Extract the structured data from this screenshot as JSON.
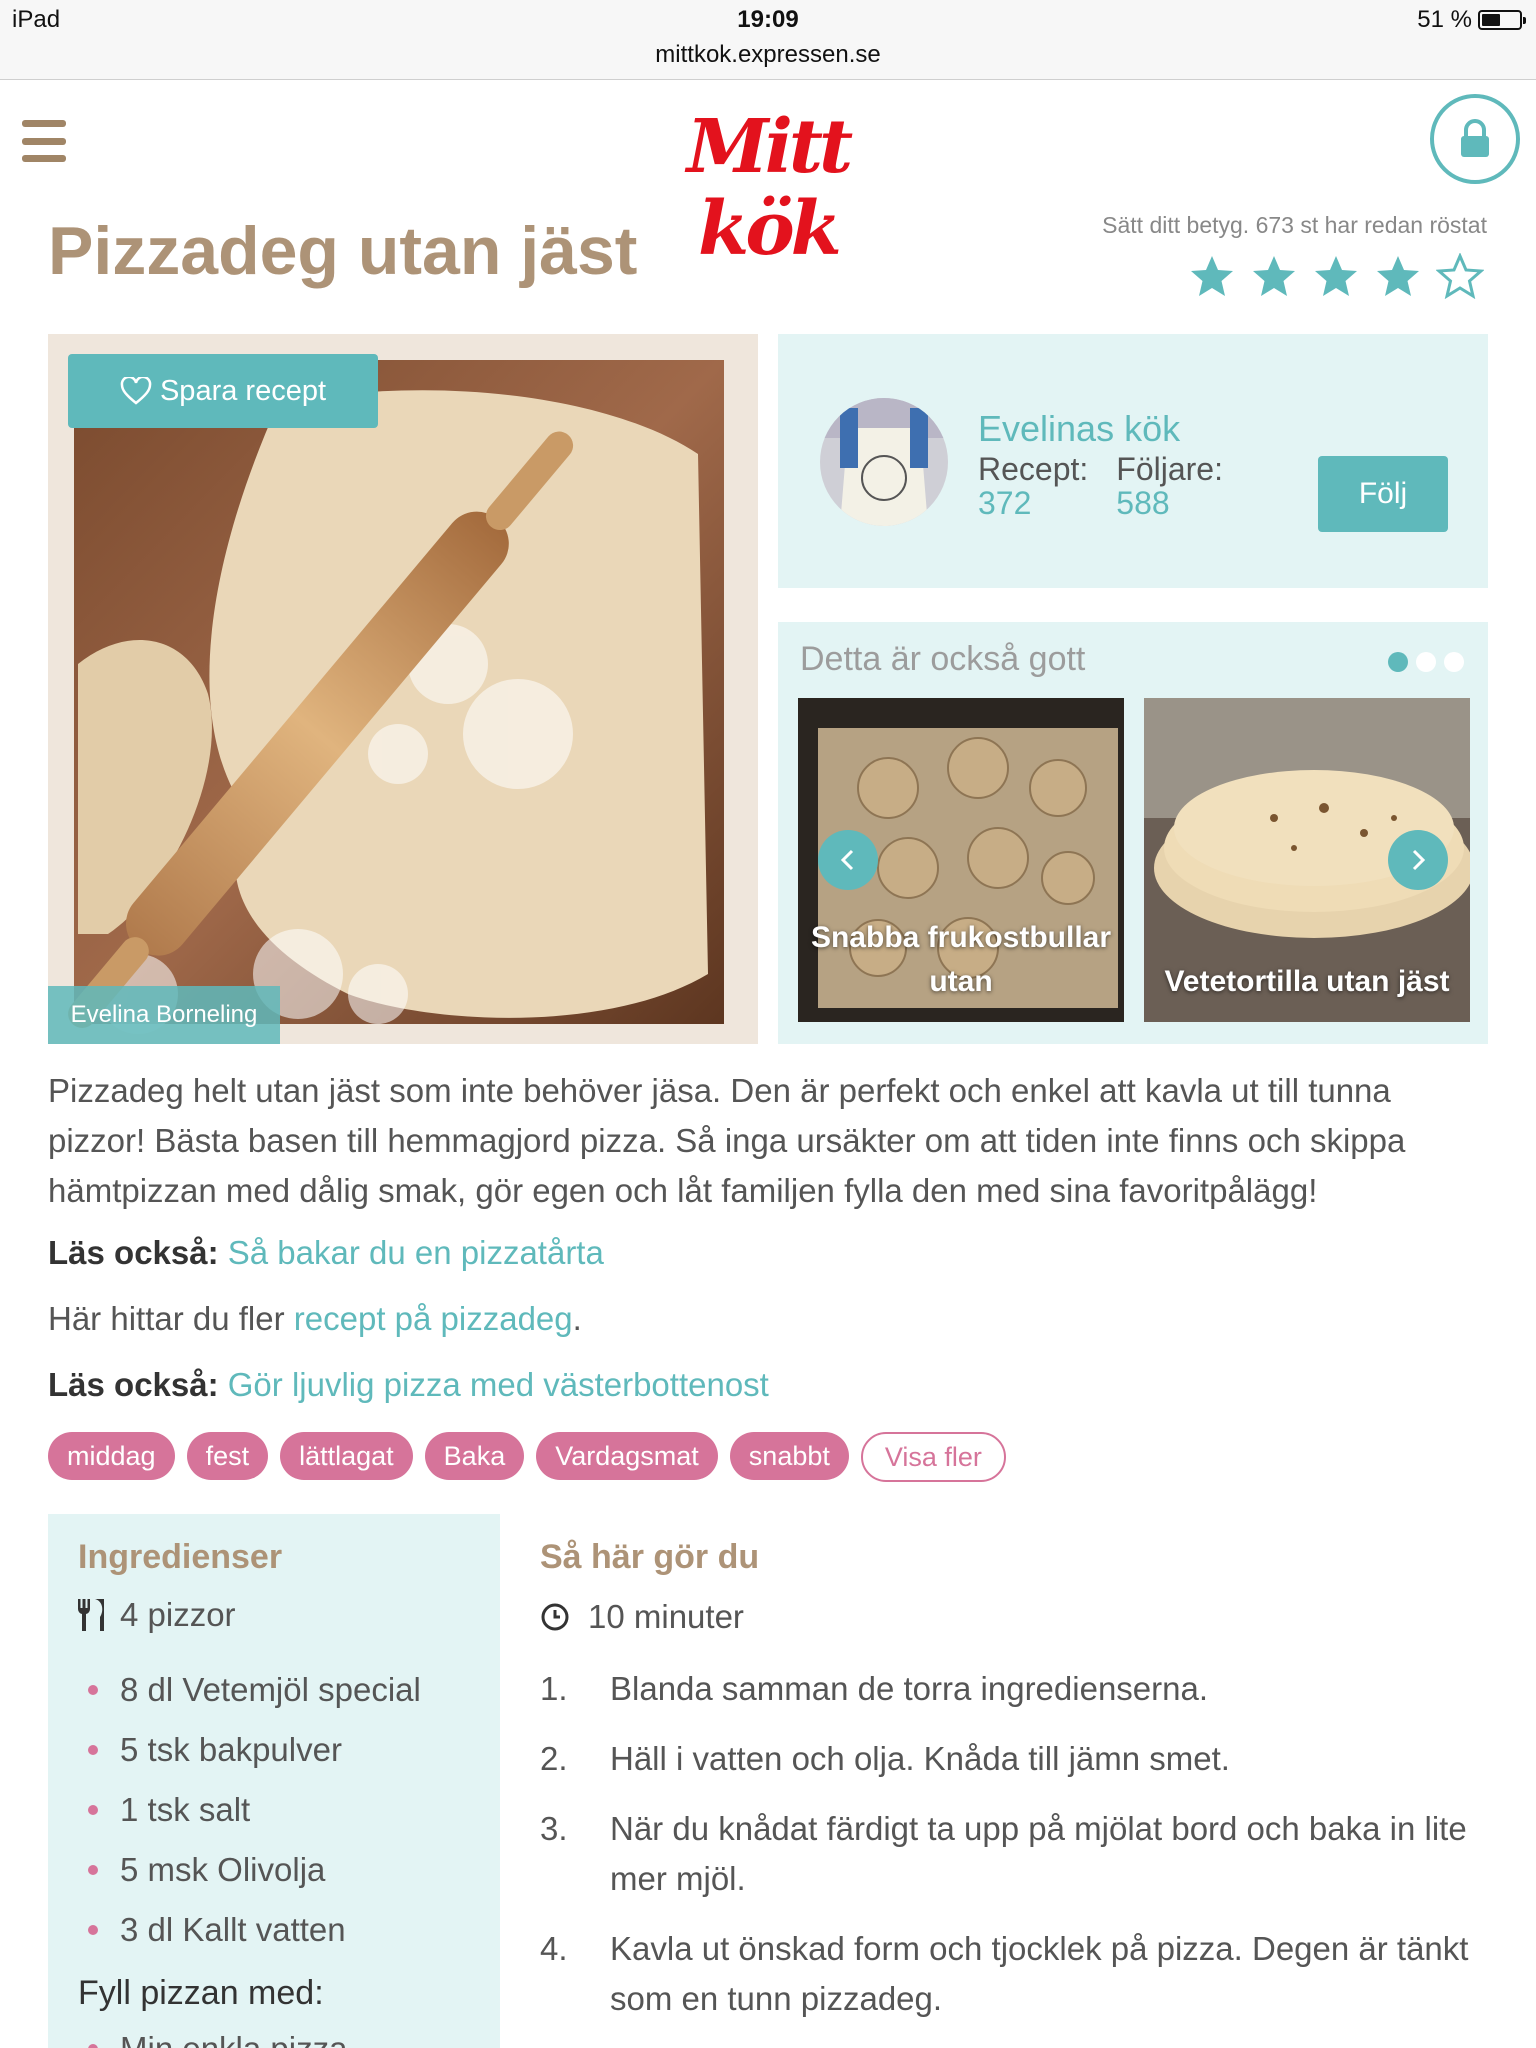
{
  "status_bar": {
    "device": "iPad",
    "time": "19:09",
    "url": "mittkok.expressen.se",
    "battery": "51 %",
    "battery_level": 0.51
  },
  "header": {
    "logo": "Mitt kök",
    "menu_icon": "hamburger-menu-icon",
    "lock_icon": "lock-icon"
  },
  "recipe": {
    "title": "Pizzadeg utan jäst",
    "rating_text": "Sätt ditt betyg. 673 st har redan röstat",
    "rating": 4,
    "rating_max": 5,
    "save_label": "Spara recept",
    "photo_credit": "Evelina Borneling"
  },
  "author": {
    "name": "Evelinas kök",
    "recipes_label": "Recept:",
    "recipes_count": "372",
    "followers_label": "Följare:",
    "followers_count": "588",
    "follow_label": "Följ"
  },
  "suggestions": {
    "title": "Detta är också gott",
    "items": [
      {
        "label": "Snabba frukostbullar utan"
      },
      {
        "label": "Vetetortilla utan jäst"
      }
    ]
  },
  "description": "Pizzadeg helt utan jäst som inte behöver jäsa. Den är perfekt och enkel att kavla ut till tunna pizzor! Bästa basen till hemmagjord pizza. Så inga ursäkter om att tiden inte finns och skippa hämtpizzan med dålig smak, gör egen och låt familjen fylla den med sina favoritpålägg!",
  "read_also_1": {
    "label": "Läs också:",
    "link": "Så bakar du en pizzatårta"
  },
  "more_line": {
    "prefix": "Här hittar du fler ",
    "link": "recept på pizzadeg",
    "suffix": "."
  },
  "read_also_2": {
    "label": "Läs också:",
    "link": "Gör ljuvlig pizza med västerbottenost"
  },
  "tags": [
    "middag",
    "fest",
    "lättlagat",
    "Baka",
    "Vardagsmat",
    "snabbt"
  ],
  "show_more_tags": "Visa fler",
  "ingredients": {
    "title": "Ingredienser",
    "portions": "4 pizzor",
    "items": [
      "8 dl Vetemjöl special",
      "5 tsk bakpulver",
      "1 tsk salt",
      "5 msk Olivolja",
      "3 dl Kallt vatten"
    ],
    "fill_title": "Fyll pizzan med:",
    "fill_items": [
      "Min enkla pizza"
    ]
  },
  "instructions": {
    "title": "Så här gör du",
    "time": "10 minuter",
    "steps": [
      {
        "num": "1.",
        "text": "Blanda samman de torra ingredienserna."
      },
      {
        "num": "2.",
        "text": "Häll i vatten och olja. Knåda till jämn smet."
      },
      {
        "num": "3.",
        "text": "När du knådat färdigt ta upp på mjölat bord och baka in lite mer mjöl."
      },
      {
        "num": "4.",
        "text": "Kavla ut önskad form och tjocklek på pizza. Degen är tänkt som en tunn pizzadeg."
      }
    ]
  },
  "colors": {
    "accent": "#5fb9bb",
    "title": "#ad9377",
    "tag": "#d6749a",
    "panel": "#e3f4f4",
    "logo": "#e3121d"
  }
}
